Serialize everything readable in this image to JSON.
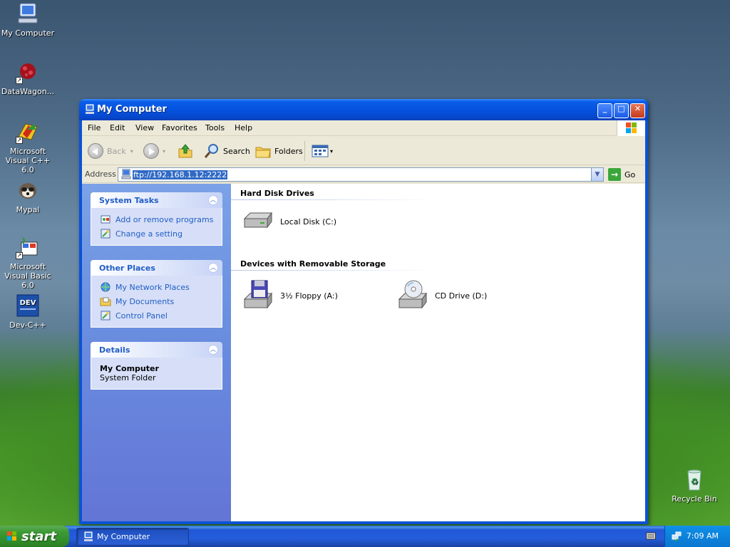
{
  "desktop": {
    "icons": [
      {
        "label": "My Computer",
        "icon": "my-computer-icon"
      },
      {
        "label": "DataWagon...",
        "icon": "datawagon-icon"
      },
      {
        "label": "Microsoft Visual C++ 6.0",
        "icon": "visual-cpp-icon"
      },
      {
        "label": "Mypal",
        "icon": "mypal-icon"
      },
      {
        "label": "Microsoft Visual Basic 6.0",
        "icon": "visual-basic-icon"
      },
      {
        "label": "Dev-C++",
        "icon": "devcpp-icon"
      },
      {
        "label": "Recycle Bin",
        "icon": "recycle-bin-icon"
      }
    ]
  },
  "window": {
    "title": "My Computer",
    "menu": [
      "File",
      "Edit",
      "View",
      "Favorites",
      "Tools",
      "Help"
    ],
    "toolbar": {
      "back": "Back",
      "search": "Search",
      "folders": "Folders"
    },
    "address": {
      "label": "Address",
      "value": "ftp://192.168.1.12:2222",
      "go": "Go"
    },
    "left_pane": {
      "system_tasks": {
        "title": "System Tasks",
        "items": [
          "Add or remove programs",
          "Change a setting"
        ]
      },
      "other_places": {
        "title": "Other Places",
        "items": [
          "My Network Places",
          "My Documents",
          "Control Panel"
        ]
      },
      "details": {
        "title": "Details",
        "name": "My Computer",
        "type": "System Folder"
      }
    },
    "content": {
      "hard_disk_title": "Hard Disk Drives",
      "hard_disks": [
        "Local Disk (C:)"
      ],
      "removable_title": "Devices with Removable Storage",
      "removable": [
        "3½ Floppy (A:)",
        "CD Drive (D:)"
      ]
    }
  },
  "taskbar": {
    "start": "start",
    "task": "My Computer",
    "clock": "7:09 AM"
  },
  "colors": {
    "titlebar": "#0553e0",
    "link_blue": "#215dc6",
    "start_green": "#3c9a34",
    "selection": "#316ac5"
  }
}
